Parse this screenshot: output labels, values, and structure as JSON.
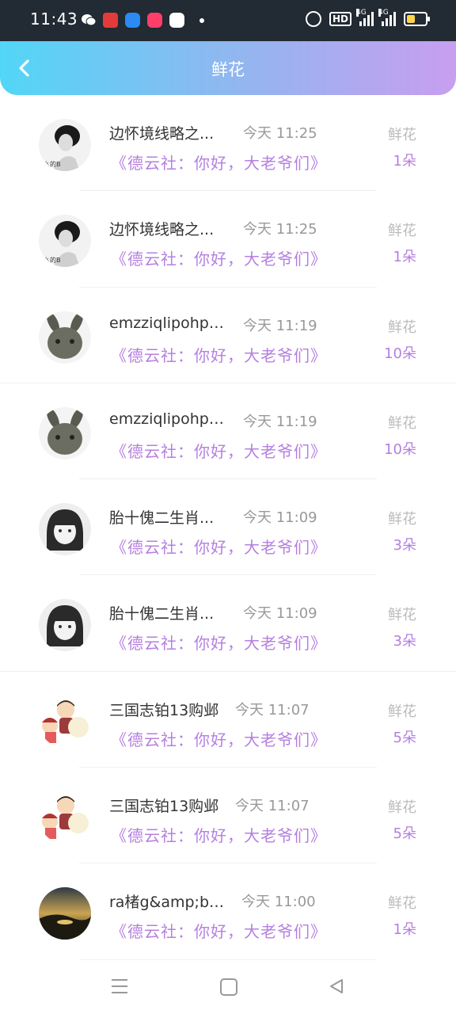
{
  "status_bar": {
    "time": "11:43",
    "notification_icons": [
      "wechat-icon",
      "news-icon",
      "browser-icon",
      "video-icon",
      "map-icon"
    ],
    "system_icons": [
      "alarm-icon",
      "hd-icon",
      "signal-4g-icon",
      "signal-4g-icon",
      "battery-icon"
    ],
    "hd_label": "HD",
    "network_label": "4G"
  },
  "header": {
    "title": "鲜花",
    "back_icon": "chevron-left-icon",
    "gradient": [
      "#52d6f7",
      "#c89ef0"
    ]
  },
  "colors": {
    "accent": "#b57fe0",
    "muted": "#999999",
    "name": "#333333"
  },
  "gift_records": [
    {
      "name": "边怀境线略之...",
      "time": "今天 11:25",
      "message": "《德云社：你好，大老爷们》",
      "gift_label": "鲜花",
      "count": "1朵",
      "avatar": "bw-woman"
    },
    {
      "name": "边怀境线略之...",
      "time": "今天 11:25",
      "message": "《德云社：你好，大老爷们》",
      "gift_label": "鲜花",
      "count": "1朵",
      "avatar": "bw-woman"
    },
    {
      "name": "emzziqlipohpu...",
      "time": "今天 11:19",
      "message": "《德云社：你好，大老爷们》",
      "gift_label": "鲜花",
      "count": "10朵",
      "avatar": "rabbit"
    },
    {
      "name": "emzziqlipohpu...",
      "time": "今天 11:19",
      "message": "《德云社：你好，大老爷们》",
      "gift_label": "鲜花",
      "count": "10朵",
      "avatar": "rabbit"
    },
    {
      "name": "胎十傀二生肖...",
      "time": "今天 11:09",
      "message": "《德云社：你好，大老爷们》",
      "gift_label": "鲜花",
      "count": "3朵",
      "avatar": "girl"
    },
    {
      "name": "胎十傀二生肖...",
      "time": "今天 11:09",
      "message": "《德云社：你好，大老爷们》",
      "gift_label": "鲜花",
      "count": "3朵",
      "avatar": "girl"
    },
    {
      "name": "三国志铂13购邺",
      "time": "今天 11:07",
      "message": "《德云社：你好，大老爷们》",
      "gift_label": "鲜花",
      "count": "5朵",
      "avatar": "cartoon"
    },
    {
      "name": "三国志铂13购邺",
      "time": "今天 11:07",
      "message": "《德云社：你好，大老爷们》",
      "gift_label": "鲜花",
      "count": "5朵",
      "avatar": "cartoon"
    },
    {
      "name": "ra楮g&amp;bone",
      "time": "今天 11:00",
      "message": "《德云社：你好，大老爷们》",
      "gift_label": "鲜花",
      "count": "1朵",
      "avatar": "landscape"
    }
  ],
  "nav_bar": {
    "icons": [
      "menu-icon",
      "home-icon",
      "back-triangle-icon"
    ]
  }
}
